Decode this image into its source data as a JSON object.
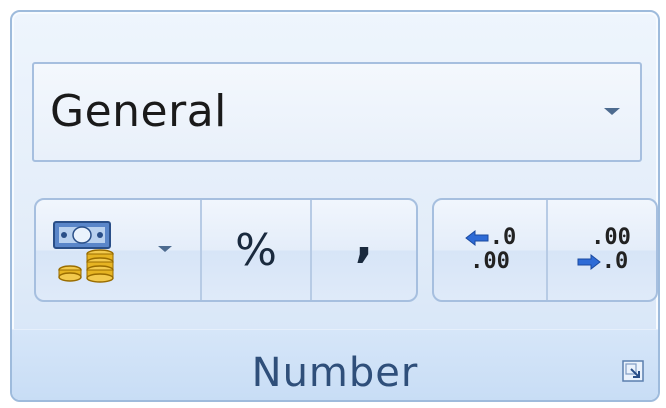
{
  "number_format": {
    "selected": "General"
  },
  "buttons": {
    "percent_symbol": "%",
    "comma_symbol": ","
  },
  "decimal_buttons": {
    "increase": {
      "top": ".0",
      "bottom": ".00"
    },
    "decrease": {
      "top": ".00",
      "bottom": ".0"
    }
  },
  "group": {
    "label": "Number"
  },
  "icons": {
    "currency": "accounting-format-icon",
    "increase_decimal": "increase-decimal-icon",
    "decrease_decimal": "decrease-decimal-icon",
    "launcher": "dialog-launcher-icon"
  },
  "colors": {
    "group_border": "#9ebbdc",
    "label_text": "#2f4f7a",
    "arrow_blue": "#2e6bd6",
    "coin_gold": "#e6b422"
  }
}
